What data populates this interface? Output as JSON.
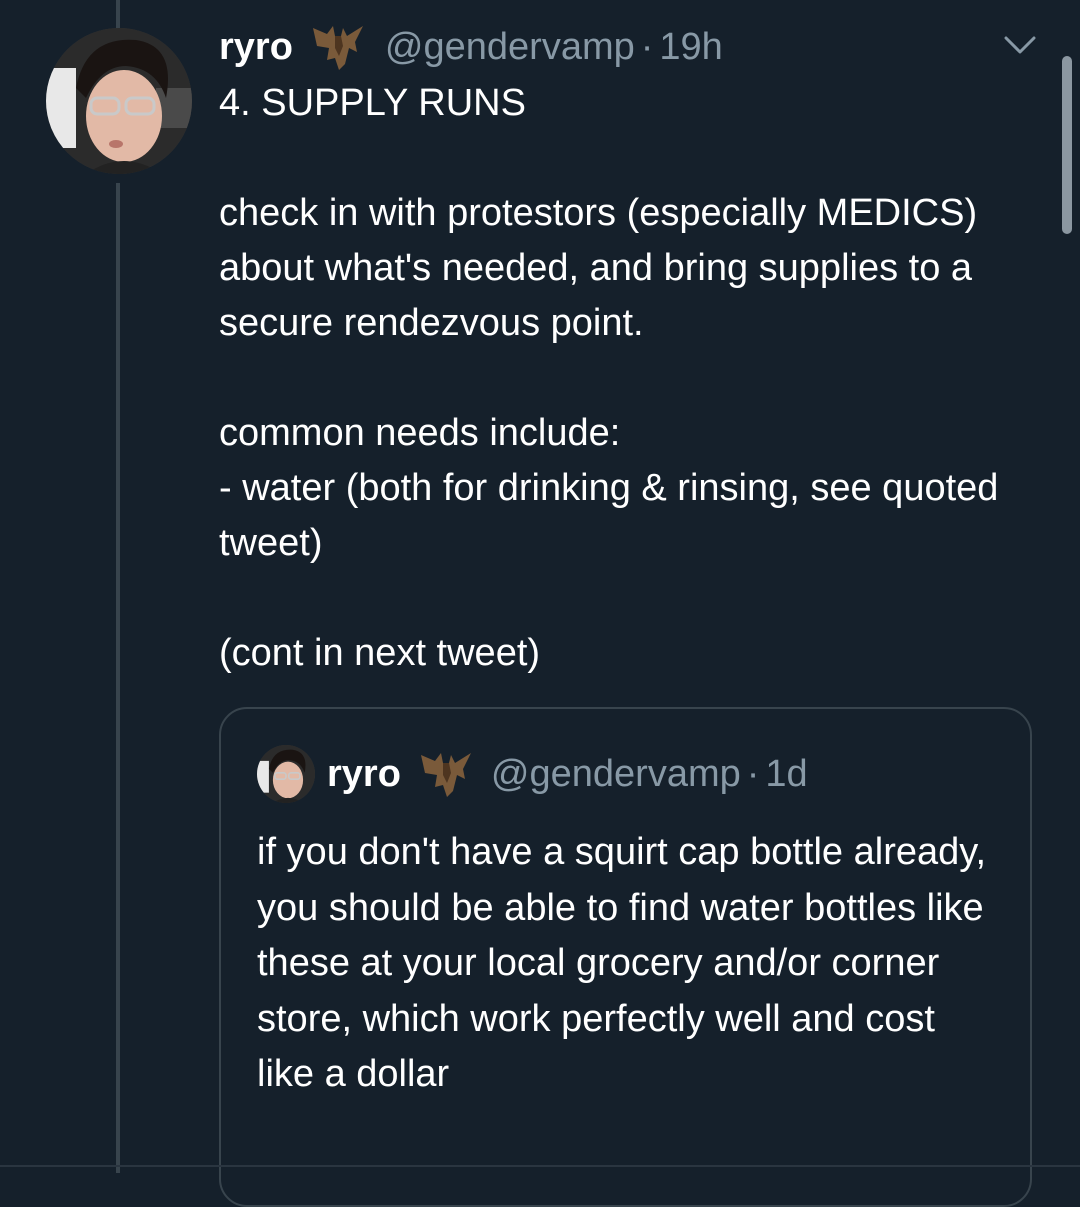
{
  "tweet": {
    "author": {
      "display_name": "ryro",
      "handle": "@gendervamp",
      "badge_icon": "bat-emoji-icon"
    },
    "separator": "·",
    "time": "19h",
    "text": "4. SUPPLY RUNS\n\ncheck in with protestors (especially MEDICS) about what's needed, and bring supplies to a secure rendezvous point.\n\ncommon needs include:\n- water (both for drinking & rinsing, see quoted tweet)\n\n(cont in next tweet)",
    "menu_icon": "chevron-down-icon"
  },
  "quoted_tweet": {
    "author": {
      "display_name": "ryro",
      "handle": "@gendervamp",
      "badge_icon": "bat-emoji-icon"
    },
    "separator": "·",
    "time": "1d",
    "text": "if you don't have a squirt cap bottle already, you should be able to find water bottles like these at your local grocery and/or corner store, which work perfectly well and cost like a dollar"
  },
  "colors": {
    "background": "#15202b",
    "primary_text": "#ffffff",
    "secondary_text": "#8899a6",
    "border": "#38444d"
  }
}
